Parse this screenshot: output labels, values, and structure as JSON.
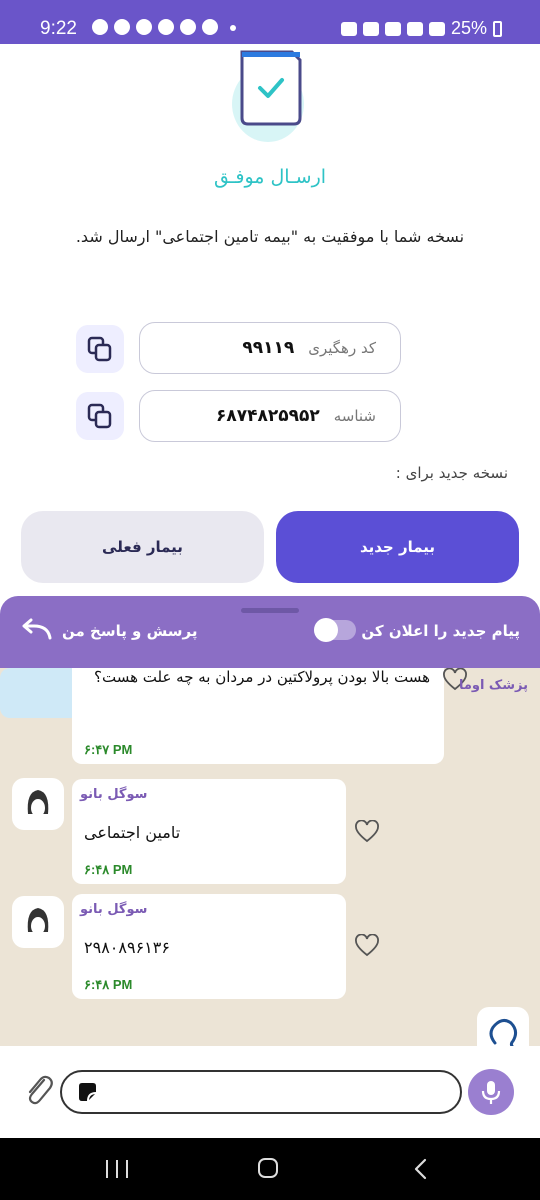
{
  "status_bar": {
    "time": "9:22",
    "battery": "25%",
    "icons": [
      "telegram-icon",
      "snapchat-icon",
      "shield-icon",
      "chat-icon",
      "eitaa-icon",
      "instagram-icon",
      "alarm-icon",
      "mute-icon",
      "wifi-icon",
      "lte1-signal-icon",
      "lte2-signal-icon",
      "battery-icon"
    ]
  },
  "success": {
    "title": "ارسـال موفـق",
    "message": "نسخه شما با موفقیت به \"بیمه تامین اجتماعی\" ارسال شد."
  },
  "fields": {
    "tracking_label": "کد رهگیری",
    "tracking_value": "۹۹۱۱۹",
    "id_label": "شناسه",
    "id_value": "۶۸۷۴۸۲۵۹۵۲"
  },
  "new_prescription_for": "نسخه جدید برای :",
  "buttons": {
    "new_patient": "بیمار جدید",
    "current_patient": "بیمار فعلی"
  },
  "chat_header": {
    "notify_label": "پیام جدید را اعلان کن",
    "qa_label": "پرسش و پاسخ من",
    "notify_enabled": false
  },
  "messages": [
    {
      "text": "هست بالا بودن پرولاکتین در مردان به چه علت هست؟",
      "time": "۶:۴۷ PM"
    },
    {
      "sender": "سوگل بانو",
      "text": "تامین اجتماعی",
      "time": "۶:۴۸ PM"
    },
    {
      "sender": "سوگل بانو",
      "text": "۲۹۸۰۸۹۶۱۳۶",
      "time": "۶:۴۸ PM"
    },
    {
      "sender": "پزشک اوما"
    }
  ],
  "composer": {
    "placeholder": ""
  },
  "colors": {
    "primary": "#5b4fd6",
    "header": "#8b6ec5",
    "success": "#2ec3c6",
    "time_green": "#2b8a2b"
  }
}
